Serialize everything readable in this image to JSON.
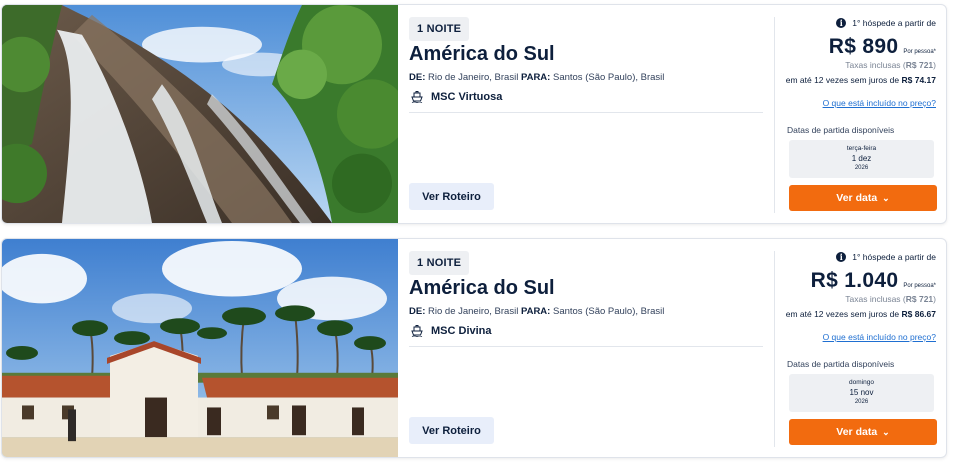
{
  "cards": [
    {
      "nights": "1 NOITE",
      "title": "América do Sul",
      "from_label": "DE:",
      "from": "Rio de Janeiro, Brasil",
      "to_label": "PARA:",
      "to": "Santos (São Paulo), Brasil",
      "ship": "MSC Virtuosa",
      "route_button": "Ver Roteiro",
      "first_guest": "1° hóspede a partir de",
      "price": "R$ 890",
      "per_person": "Por pessoa*",
      "taxes_prefix": "Taxas inclusas (",
      "taxes_value": "R$ 721",
      "taxes_suffix": ")",
      "installments_prefix": "em até 12 vezes sem juros de",
      "installments_value": "R$ 74.17",
      "included_link": "O que está incluído no preço?",
      "dates_label": "Datas de partida disponíveis",
      "date_weekday": "terça-feira",
      "date_day": "1 dez",
      "date_year": "2026",
      "date_button": "Ver data",
      "image_icon": "waterfall-photo"
    },
    {
      "nights": "1 NOITE",
      "title": "América do Sul",
      "from_label": "DE:",
      "from": "Rio de Janeiro, Brasil",
      "to_label": "PARA:",
      "to": "Santos (São Paulo), Brasil",
      "ship": "MSC Divina",
      "route_button": "Ver Roteiro",
      "first_guest": "1° hóspede a partir de",
      "price": "R$ 1.040",
      "per_person": "Por pessoa*",
      "taxes_prefix": "Taxas inclusas (",
      "taxes_value": "R$ 721",
      "taxes_suffix": ")",
      "installments_prefix": "em até 12 vezes sem juros de",
      "installments_value": "R$ 86.67",
      "included_link": "O que está incluído no preço?",
      "dates_label": "Datas de partida disponíveis",
      "date_weekday": "domingo",
      "date_day": "15 nov",
      "date_year": "2026",
      "date_button": "Ver data",
      "image_icon": "colonial-church-palms-photo"
    }
  ],
  "colors": {
    "primary_text": "#0d1f3c",
    "accent_orange": "#f26b0f",
    "link_blue": "#1f6fd1",
    "route_button_bg": "#e8eefa"
  },
  "icons": {
    "info": "info-icon",
    "ship": "ship-icon",
    "chevron": "chevron-down-icon"
  }
}
